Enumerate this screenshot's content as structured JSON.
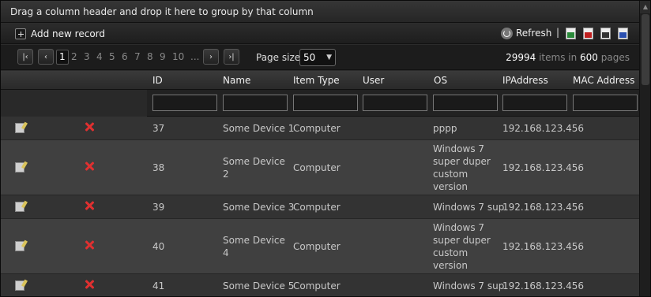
{
  "groupbar": {
    "text": "Drag a column header and drop it here to group by that column"
  },
  "toolbar": {
    "add_label": "Add new record",
    "refresh_label": "Refresh",
    "separator": "|",
    "export_icons": [
      "excel-export-icon",
      "pdf-export-icon",
      "csv-export-icon",
      "word-export-icon"
    ]
  },
  "pager": {
    "first": "|‹",
    "prev": "‹",
    "next": "›",
    "last": "›|",
    "pages": [
      "1",
      "2",
      "3",
      "4",
      "5",
      "6",
      "7",
      "8",
      "9",
      "10",
      "..."
    ],
    "current_page": "1",
    "page_size_label": "Page size:",
    "page_size": "50",
    "total_items": "29994",
    "items_in": "items in",
    "total_pages": "600",
    "pages_label": "pages"
  },
  "columns": [
    "ID",
    "Name",
    "Item Type",
    "User",
    "OS",
    "IPAddress",
    "MAC Address"
  ],
  "rows": [
    {
      "id": "37",
      "name": [
        "Some Device 1"
      ],
      "type": "Computer",
      "user": "",
      "os": [
        "pppp"
      ],
      "ip": "192.168.123.456",
      "mac": ""
    },
    {
      "id": "38",
      "name": [
        "Some Device",
        "2"
      ],
      "type": "Computer",
      "user": "",
      "os": [
        "Windows 7",
        "super duper",
        "custom",
        "version"
      ],
      "ip": "192.168.123.456",
      "mac": ""
    },
    {
      "id": "39",
      "name": [
        "Some Device 3"
      ],
      "type": "Computer",
      "user": "",
      "os": [
        "Windows 7 sup"
      ],
      "ip": "192.168.123.456",
      "mac": ""
    },
    {
      "id": "40",
      "name": [
        "Some Device",
        "4"
      ],
      "type": "Computer",
      "user": "",
      "os": [
        "Windows 7",
        "super duper",
        "custom",
        "version"
      ],
      "ip": "192.168.123.456",
      "mac": ""
    },
    {
      "id": "41",
      "name": [
        "Some Device 5"
      ],
      "type": "Computer",
      "user": "",
      "os": [
        "Windows 7 sup"
      ],
      "ip": "192.168.123.456",
      "mac": ""
    }
  ]
}
